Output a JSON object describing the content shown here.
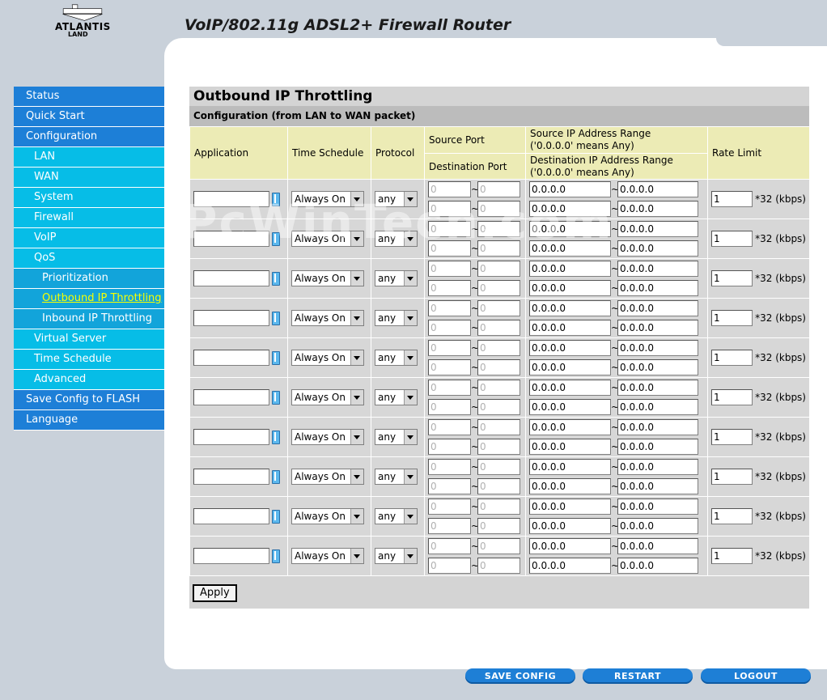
{
  "header": {
    "logo_text": "ATLANTIS",
    "logo_sub": "LAND",
    "title": "VoIP/802.11g ADSL2+ Firewall Router"
  },
  "sidebar": {
    "items": [
      {
        "label": "Status",
        "level": 0
      },
      {
        "label": "Quick Start",
        "level": 0
      },
      {
        "label": "Configuration",
        "level": 0
      },
      {
        "label": "LAN",
        "level": 1
      },
      {
        "label": "WAN",
        "level": 1
      },
      {
        "label": "System",
        "level": 1
      },
      {
        "label": "Firewall",
        "level": 1
      },
      {
        "label": "VoIP",
        "level": 1
      },
      {
        "label": "QoS",
        "level": 1
      },
      {
        "label": "Prioritization",
        "level": 2
      },
      {
        "label": "Outbound IP Throttling",
        "level": 2,
        "active": true
      },
      {
        "label": "Inbound IP Throttling",
        "level": 2
      },
      {
        "label": "Virtual Server",
        "level": 1
      },
      {
        "label": "Time Schedule",
        "level": 1
      },
      {
        "label": "Advanced",
        "level": 1
      },
      {
        "label": "Save Config to FLASH",
        "level": 0
      },
      {
        "label": "Language",
        "level": 0
      }
    ]
  },
  "page": {
    "title": "Outbound IP Throttling",
    "section": "Configuration (from LAN to WAN packet)",
    "headers": {
      "application": "Application",
      "time_schedule": "Time Schedule",
      "protocol": "Protocol",
      "source_port": "Source Port",
      "destination_port": "Destination Port",
      "source_ip": "Source IP Address Range",
      "source_ip_note": "('0.0.0.0' means Any)",
      "dest_ip": "Destination IP Address Range",
      "dest_ip_note": "('0.0.0.0' means Any)",
      "rate_limit": "Rate Limit"
    },
    "row_defaults": {
      "application": "",
      "time_schedule": "Always On",
      "protocol": "any",
      "port_start": "0",
      "port_end": "0",
      "ip_start": "0.0.0.0",
      "ip_end": "0.0.0.0",
      "rate": "1",
      "rate_unit": "*32 (kbps)"
    },
    "row_count": 10,
    "apply_label": "Apply"
  },
  "footer": {
    "save_config": "SAVE CONFIG",
    "restart": "RESTART",
    "logout": "LOGOUT"
  },
  "watermark": "PcWinTech.com",
  "colors": {
    "nav_top": "#1d7fd7",
    "nav_sub": "#06bde7",
    "nav_sub2": "#12a4da",
    "nav_active_text": "#f6ff00",
    "table_header": "#ecebb5",
    "table_cell": "#d7d7d7",
    "footer_button": "#1e7fd6"
  }
}
